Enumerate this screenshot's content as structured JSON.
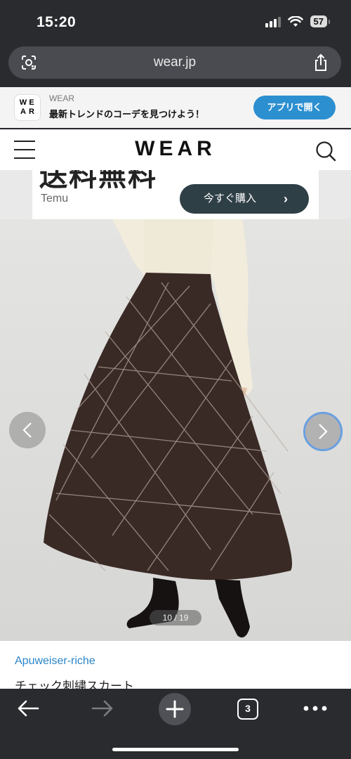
{
  "status": {
    "time": "15:20",
    "battery": "57"
  },
  "browser": {
    "url": "wear.jp"
  },
  "app_banner": {
    "logo_letters": [
      "W",
      "E",
      "A",
      "R"
    ],
    "app_name": "WEAR",
    "tagline": "最新トレンドのコーデを見つけよう！",
    "open_button": "アプリで開く"
  },
  "header": {
    "logo": "WEAR"
  },
  "ad": {
    "brand": "Temu",
    "cta": "今すぐ購入",
    "cut_text": "送料無料"
  },
  "gallery": {
    "counter": "10 / 19"
  },
  "product": {
    "brand": "Apuweiser-riche",
    "name": "チェック刺繍スカート"
  },
  "toolbar": {
    "tab_count": "3"
  },
  "colors": {
    "accent": "#2c8fd0",
    "link": "#2b86c9",
    "dark_bg": "#2a2b2f",
    "skirt": "#3a2a26"
  }
}
